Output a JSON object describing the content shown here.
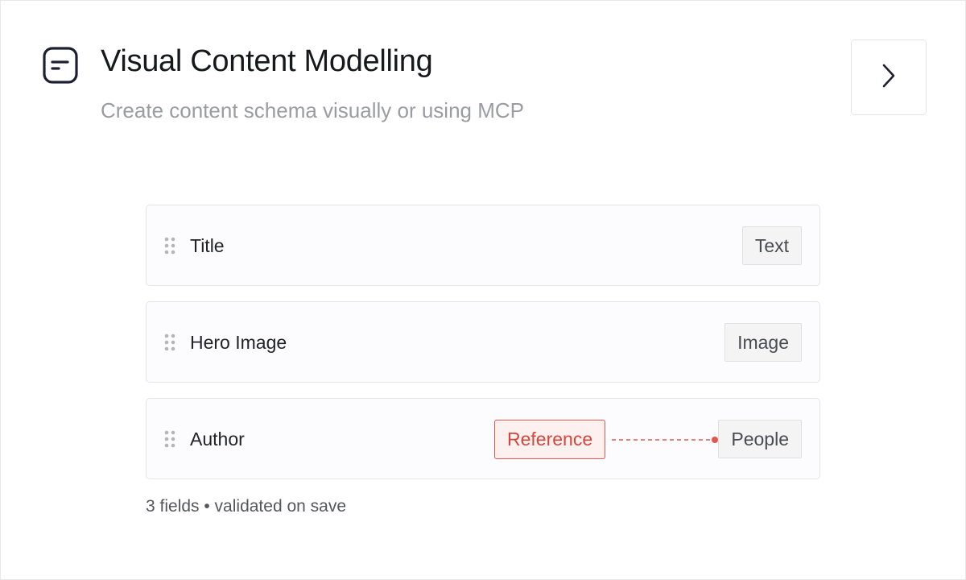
{
  "header": {
    "title": "Visual Content Modelling",
    "subtitle": "Create content schema visually or using MCP",
    "icon": "document-lines-icon",
    "next_icon": "chevron-right-icon"
  },
  "fields": [
    {
      "name": "Title",
      "type": "Text"
    },
    {
      "name": "Hero Image",
      "type": "Image"
    },
    {
      "name": "Author",
      "reference": "Reference",
      "type": "People"
    }
  ],
  "footer": {
    "summary": "3 fields • validated on save"
  },
  "colors": {
    "reference": "#e0574f",
    "text_primary": "#17181c",
    "text_muted": "#9b9ca3"
  }
}
